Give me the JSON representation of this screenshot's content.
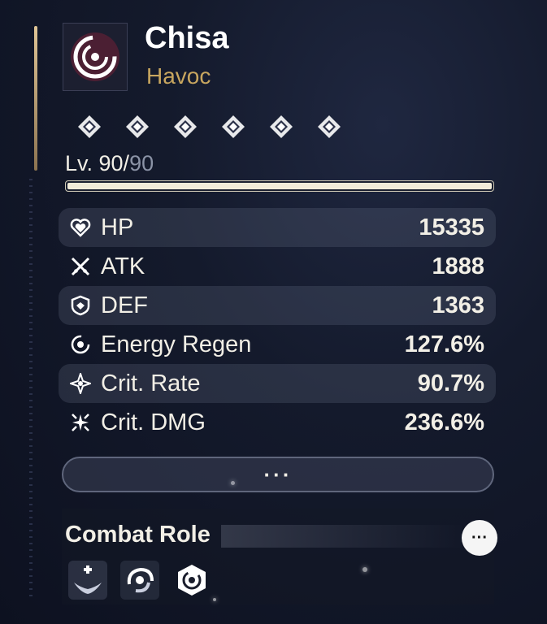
{
  "character": {
    "name": "Chisa",
    "attribute": "Havoc",
    "attribute_color": "#c8a65f",
    "element_icon": "havoc-icon"
  },
  "resonance_chain": {
    "unlocked": 6,
    "total": 6,
    "icon": "diamond-icon"
  },
  "level": {
    "current": "Lv. 90/",
    "max": "90",
    "progress": 1.0
  },
  "stats": [
    {
      "icon": "heart-icon",
      "label": "HP",
      "value": "15335"
    },
    {
      "icon": "swords-icon",
      "label": "ATK",
      "value": "1888"
    },
    {
      "icon": "shield-icon",
      "label": "DEF",
      "value": "1363"
    },
    {
      "icon": "energy-regen-icon",
      "label": "Energy Regen",
      "value": "127.6%"
    },
    {
      "icon": "crit-rate-icon",
      "label": "Crit. Rate",
      "value": "90.7%"
    },
    {
      "icon": "crit-dmg-icon",
      "label": "Crit. DMG",
      "value": "236.6%"
    }
  ],
  "more_button_label": "···",
  "combat_role": {
    "title": "Combat Role",
    "more_label": "···",
    "roles": [
      "healer-wings-icon",
      "havoc-swirl-icon",
      "havoc-hex-icon"
    ]
  }
}
